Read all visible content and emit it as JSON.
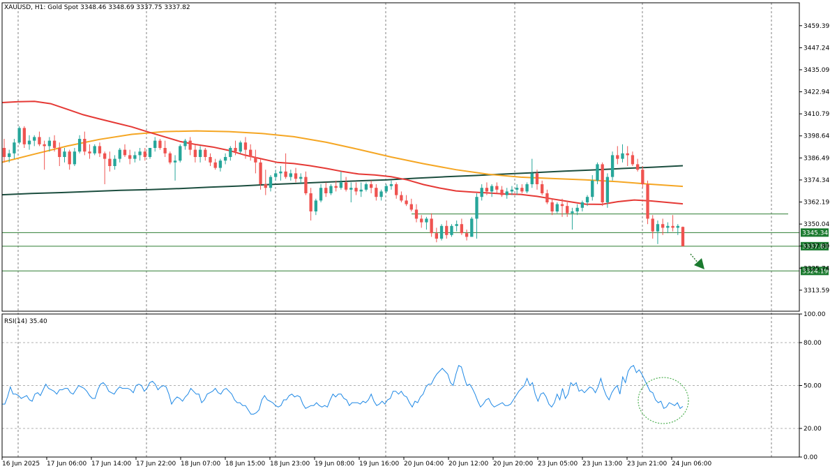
{
  "header": {
    "symbol_line": "XAUUSD, H1:  Gold Spot  3348.46 3348.69 3337.75 3337.82"
  },
  "rsi_header": "RSI(14) 35.40",
  "colors": {
    "bull": "#26a69a",
    "bear": "#ef5350",
    "ma_fast": "#e53935",
    "ma_mid": "#f5a623",
    "ma_slow": "#1b4d3e",
    "level_line": "#2e7d32",
    "rsi_line": "#1e88e5",
    "grid": "#808080"
  },
  "chart_data": [
    {
      "type": "candlestick",
      "title": "XAUUSD, H1:  Gold Spot",
      "ylim": [
        3302,
        3472
      ],
      "y_ticks": [
        "3459.39",
        "3447.24",
        "3435.09",
        "3422.94",
        "3410.79",
        "3398.64",
        "3386.49",
        "3374.34",
        "3362.19",
        "3350.04",
        "3337.89",
        "3325.74",
        "3313.59"
      ],
      "x_ticks": [
        "16 Jun 2025",
        "17 Jun 06:00",
        "17 Jun 14:00",
        "17 Jun 22:00",
        "18 Jun 07:00",
        "18 Jun 15:00",
        "18 Jun 23:00",
        "19 Jun 08:00",
        "19 Jun 16:00",
        "20 Jun 04:00",
        "20 Jun 12:00",
        "20 Jun 20:00",
        "23 Jun 05:00",
        "23 Jun 13:00",
        "23 Jun 21:00",
        "24 Jun 06:00"
      ],
      "last_ohlc": {
        "open": 3348.46,
        "high": 3348.69,
        "low": 3337.75,
        "close": 3337.82
      },
      "candles_ohlc": [
        [
          3392,
          3397,
          3384,
          3387
        ],
        [
          3387,
          3391,
          3384,
          3389
        ],
        [
          3389,
          3397,
          3386,
          3395
        ],
        [
          3395,
          3404,
          3394,
          3403
        ],
        [
          3403,
          3404,
          3392,
          3394
        ],
        [
          3394,
          3399,
          3391,
          3396
        ],
        [
          3396,
          3399,
          3393,
          3398
        ],
        [
          3398,
          3401,
          3393,
          3394
        ],
        [
          3394,
          3396,
          3380,
          3393
        ],
        [
          3393,
          3398,
          3390,
          3396
        ],
        [
          3396,
          3399,
          3390,
          3392
        ],
        [
          3392,
          3395,
          3382,
          3387
        ],
        [
          3387,
          3392,
          3384,
          3390
        ],
        [
          3390,
          3391,
          3380,
          3383
        ],
        [
          3383,
          3392,
          3382,
          3390
        ],
        [
          3390,
          3399,
          3389,
          3397
        ],
        [
          3397,
          3401,
          3388,
          3390
        ],
        [
          3390,
          3394,
          3386,
          3389
        ],
        [
          3389,
          3394,
          3388,
          3393
        ],
        [
          3393,
          3395,
          3387,
          3389
        ],
        [
          3389,
          3390,
          3372,
          3386
        ],
        [
          3386,
          3390,
          3379,
          3382
        ],
        [
          3382,
          3388,
          3380,
          3386
        ],
        [
          3386,
          3392,
          3384,
          3391
        ],
        [
          3391,
          3394,
          3387,
          3388
        ],
        [
          3388,
          3391,
          3383,
          3386
        ],
        [
          3386,
          3390,
          3384,
          3388
        ],
        [
          3388,
          3392,
          3385,
          3390
        ],
        [
          3390,
          3392,
          3385,
          3387
        ],
        [
          3387,
          3392,
          3386,
          3392
        ],
        [
          3392,
          3398,
          3390,
          3396
        ],
        [
          3396,
          3397,
          3391,
          3392
        ],
        [
          3392,
          3396,
          3387,
          3389
        ],
        [
          3389,
          3390,
          3383,
          3384
        ],
        [
          3384,
          3388,
          3374,
          3385
        ],
        [
          3385,
          3394,
          3384,
          3393
        ],
        [
          3393,
          3397,
          3391,
          3396
        ],
        [
          3396,
          3398,
          3388,
          3391
        ],
        [
          3391,
          3394,
          3384,
          3387
        ],
        [
          3387,
          3393,
          3384,
          3391
        ],
        [
          3391,
          3392,
          3385,
          3387
        ],
        [
          3387,
          3389,
          3382,
          3384
        ],
        [
          3384,
          3386,
          3380,
          3381
        ],
        [
          3381,
          3386,
          3379,
          3385
        ],
        [
          3385,
          3389,
          3383,
          3387
        ],
        [
          3387,
          3393,
          3385,
          3392
        ],
        [
          3392,
          3396,
          3388,
          3390
        ],
        [
          3390,
          3396,
          3389,
          3395
        ],
        [
          3395,
          3398,
          3386,
          3391
        ],
        [
          3391,
          3394,
          3385,
          3387
        ],
        [
          3387,
          3391,
          3378,
          3384
        ],
        [
          3384,
          3386,
          3369,
          3372
        ],
        [
          3372,
          3380,
          3366,
          3370
        ],
        [
          3370,
          3377,
          3368,
          3376
        ],
        [
          3376,
          3380,
          3374,
          3378
        ],
        [
          3378,
          3382,
          3374,
          3379
        ],
        [
          3379,
          3389,
          3375,
          3376
        ],
        [
          3376,
          3380,
          3374,
          3378
        ],
        [
          3378,
          3381,
          3373,
          3375
        ],
        [
          3375,
          3378,
          3372,
          3376
        ],
        [
          3376,
          3379,
          3366,
          3367
        ],
        [
          3367,
          3370,
          3352,
          3357
        ],
        [
          3357,
          3364,
          3355,
          3363
        ],
        [
          3363,
          3372,
          3362,
          3370
        ],
        [
          3370,
          3373,
          3365,
          3367
        ],
        [
          3367,
          3372,
          3366,
          3371
        ],
        [
          3371,
          3374,
          3368,
          3370
        ],
        [
          3370,
          3379,
          3369,
          3373
        ],
        [
          3373,
          3376,
          3368,
          3369
        ],
        [
          3369,
          3373,
          3362,
          3370
        ],
        [
          3370,
          3373,
          3366,
          3368
        ],
        [
          3368,
          3373,
          3365,
          3369
        ],
        [
          3369,
          3373,
          3368,
          3372
        ],
        [
          3372,
          3374,
          3367,
          3370
        ],
        [
          3370,
          3372,
          3363,
          3365
        ],
        [
          3365,
          3369,
          3363,
          3368
        ],
        [
          3368,
          3372,
          3367,
          3371
        ],
        [
          3371,
          3374,
          3369,
          3372
        ],
        [
          3372,
          3373,
          3364,
          3366
        ],
        [
          3366,
          3368,
          3362,
          3363
        ],
        [
          3363,
          3366,
          3360,
          3361
        ],
        [
          3361,
          3364,
          3357,
          3358
        ],
        [
          3358,
          3361,
          3351,
          3353
        ],
        [
          3353,
          3355,
          3348,
          3351
        ],
        [
          3351,
          3354,
          3347,
          3353
        ],
        [
          3353,
          3356,
          3343,
          3345
        ],
        [
          3345,
          3348,
          3340,
          3342
        ],
        [
          3342,
          3350,
          3341,
          3349
        ],
        [
          3349,
          3352,
          3342,
          3344
        ],
        [
          3344,
          3350,
          3343,
          3349
        ],
        [
          3349,
          3352,
          3346,
          3350
        ],
        [
          3350,
          3353,
          3344,
          3345
        ],
        [
          3345,
          3347,
          3341,
          3343
        ],
        [
          3343,
          3354,
          3343,
          3353
        ],
        [
          3353,
          3367,
          3342,
          3365
        ],
        [
          3365,
          3372,
          3363,
          3370
        ],
        [
          3370,
          3373,
          3366,
          3368
        ],
        [
          3368,
          3372,
          3365,
          3371
        ],
        [
          3371,
          3373,
          3367,
          3369
        ],
        [
          3369,
          3371,
          3365,
          3366
        ],
        [
          3366,
          3370,
          3364,
          3368
        ],
        [
          3368,
          3371,
          3366,
          3369
        ],
        [
          3369,
          3372,
          3366,
          3370
        ],
        [
          3370,
          3372,
          3367,
          3368
        ],
        [
          3368,
          3373,
          3367,
          3372
        ],
        [
          3372,
          3386,
          3370,
          3378
        ],
        [
          3378,
          3380,
          3369,
          3372
        ],
        [
          3372,
          3374,
          3366,
          3367
        ],
        [
          3367,
          3369,
          3361,
          3362
        ],
        [
          3362,
          3364,
          3355,
          3357
        ],
        [
          3357,
          3362,
          3356,
          3361
        ],
        [
          3361,
          3364,
          3354,
          3360
        ],
        [
          3360,
          3362,
          3354,
          3356
        ],
        [
          3356,
          3359,
          3347,
          3357
        ],
        [
          3357,
          3361,
          3355,
          3359
        ],
        [
          3359,
          3363,
          3357,
          3362
        ],
        [
          3362,
          3366,
          3360,
          3365
        ],
        [
          3365,
          3377,
          3363,
          3374
        ],
        [
          3374,
          3384,
          3372,
          3383
        ],
        [
          3383,
          3384,
          3360,
          3362
        ],
        [
          3362,
          3378,
          3359,
          3376
        ],
        [
          3376,
          3390,
          3374,
          3388
        ],
        [
          3388,
          3393,
          3383,
          3386
        ],
        [
          3386,
          3394,
          3384,
          3389
        ],
        [
          3389,
          3393,
          3382,
          3388
        ],
        [
          3388,
          3390,
          3382,
          3383
        ],
        [
          3383,
          3386,
          3379,
          3380
        ],
        [
          3380,
          3382,
          3370,
          3372
        ],
        [
          3372,
          3374,
          3350,
          3353
        ],
        [
          3353,
          3355,
          3342,
          3346
        ],
        [
          3346,
          3352,
          3339,
          3350
        ],
        [
          3350,
          3353,
          3344,
          3348
        ],
        [
          3348,
          3351,
          3345,
          3349
        ],
        [
          3349,
          3355,
          3346,
          3348
        ],
        [
          3348,
          3350,
          3344,
          3349
        ],
        [
          3348.46,
          3348.69,
          3337.75,
          3337.82
        ]
      ],
      "moving_averages": [
        {
          "color_key": "ma_slow",
          "values": [
            3366.2,
            3366.9,
            3367.4,
            3368.0,
            3368.6,
            3369.0,
            3369.6,
            3370.4,
            3371.0,
            3371.8,
            3372.5,
            3373.2,
            3373.8,
            3374.4,
            3375.3,
            3376.1,
            3376.8,
            3377.6,
            3378.4,
            3379.2,
            3379.9,
            3380.7,
            3381.4,
            3382.2
          ]
        },
        {
          "color_key": "ma_mid",
          "values": [
            3384.1,
            3388.6,
            3393.0,
            3396.7,
            3399.5,
            3401.0,
            3401.4,
            3401.0,
            3400.0,
            3398.2,
            3395.1,
            3391.2,
            3387.0,
            3383.3,
            3380.0,
            3377.5,
            3375.9,
            3375.1,
            3374.4,
            3373.4,
            3372.0,
            3370.8
          ]
        },
        {
          "color_key": "ma_fast",
          "values": [
            3417.0,
            3417.5,
            3417.7,
            3416.4,
            3413.4,
            3410.3,
            3408.0,
            3405.8,
            3403.6,
            3400.8,
            3398.2,
            3395.5,
            3393.8,
            3392.5,
            3390.6,
            3388.0,
            3386.0,
            3384.0,
            3383.4,
            3382.2,
            3380.7,
            3379.0,
            3377.6,
            3377.1,
            3376.1,
            3374.4,
            3371.8,
            3369.9,
            3368.3,
            3367.7,
            3367.2,
            3366.6,
            3366.4,
            3365.3,
            3363.8,
            3362.4,
            3361.0,
            3360.9,
            3362.4,
            3363.3,
            3362.8,
            3362.0,
            3361.2
          ]
        }
      ],
      "level_lines": [
        {
          "value": 3345.34,
          "label": "3345.34"
        },
        {
          "value": 3337.83,
          "label": "3337.83"
        },
        {
          "value": 3324.19,
          "label": "3324.19"
        },
        {
          "value": 3355.6,
          "label": ""
        }
      ]
    },
    {
      "type": "line",
      "title": "RSI(14) 35.40",
      "ylim": [
        0,
        100
      ],
      "y_ticks": [
        "100.00",
        "80.00",
        "50.00",
        "20.00",
        "0.00"
      ],
      "values": [
        37,
        37,
        42,
        49,
        44,
        44,
        43,
        41,
        42,
        43,
        40,
        39,
        44,
        45,
        43,
        47,
        51,
        48,
        47,
        46,
        44,
        47,
        47,
        48,
        48,
        45,
        44,
        47,
        50,
        49,
        48,
        46,
        43,
        41,
        41,
        47,
        51,
        52,
        50,
        46,
        45,
        44,
        47,
        49,
        48,
        48,
        48,
        47,
        45,
        50,
        51,
        50,
        46,
        48,
        52,
        53,
        51,
        47,
        49,
        50,
        49,
        44,
        37,
        40,
        42,
        41,
        39,
        42,
        44,
        48,
        46,
        44,
        44,
        38,
        40,
        44,
        45,
        46,
        48,
        45,
        44,
        47,
        48,
        46,
        44,
        40,
        38,
        38,
        36,
        36,
        33,
        30,
        30,
        31,
        33,
        40,
        43,
        40,
        39,
        38,
        36,
        35,
        36,
        40,
        40,
        43,
        44,
        42,
        43,
        42,
        37,
        34,
        35,
        36,
        36,
        38,
        36,
        35,
        36,
        35,
        40,
        44,
        42,
        44,
        44,
        41,
        40,
        36,
        38,
        38,
        38,
        37,
        39,
        38,
        40,
        44,
        39,
        36,
        37,
        39,
        37,
        40,
        41,
        46,
        46,
        44,
        46,
        43,
        42,
        38,
        35,
        39,
        38,
        42,
        44,
        49,
        51,
        51,
        55,
        58,
        60,
        62,
        60,
        58,
        52,
        50,
        58,
        64,
        63,
        56,
        50,
        51,
        48,
        44,
        39,
        35,
        37,
        40,
        41,
        37,
        35,
        36,
        37,
        38,
        36,
        36,
        37,
        40,
        43,
        46,
        48,
        50,
        55,
        50,
        52,
        44,
        39,
        44,
        45,
        42,
        37,
        35,
        38,
        44,
        40,
        48,
        41,
        44,
        52,
        50,
        52,
        46,
        47,
        45,
        47,
        49,
        48,
        45,
        49,
        55,
        48,
        43,
        40,
        45,
        48,
        50,
        44,
        56,
        52,
        60,
        63,
        64,
        59,
        61,
        58,
        54,
        50,
        46,
        45,
        40,
        38,
        39,
        34,
        35,
        38,
        37,
        36,
        38,
        34,
        35.4
      ],
      "levels": [
        80,
        50,
        20
      ]
    }
  ]
}
